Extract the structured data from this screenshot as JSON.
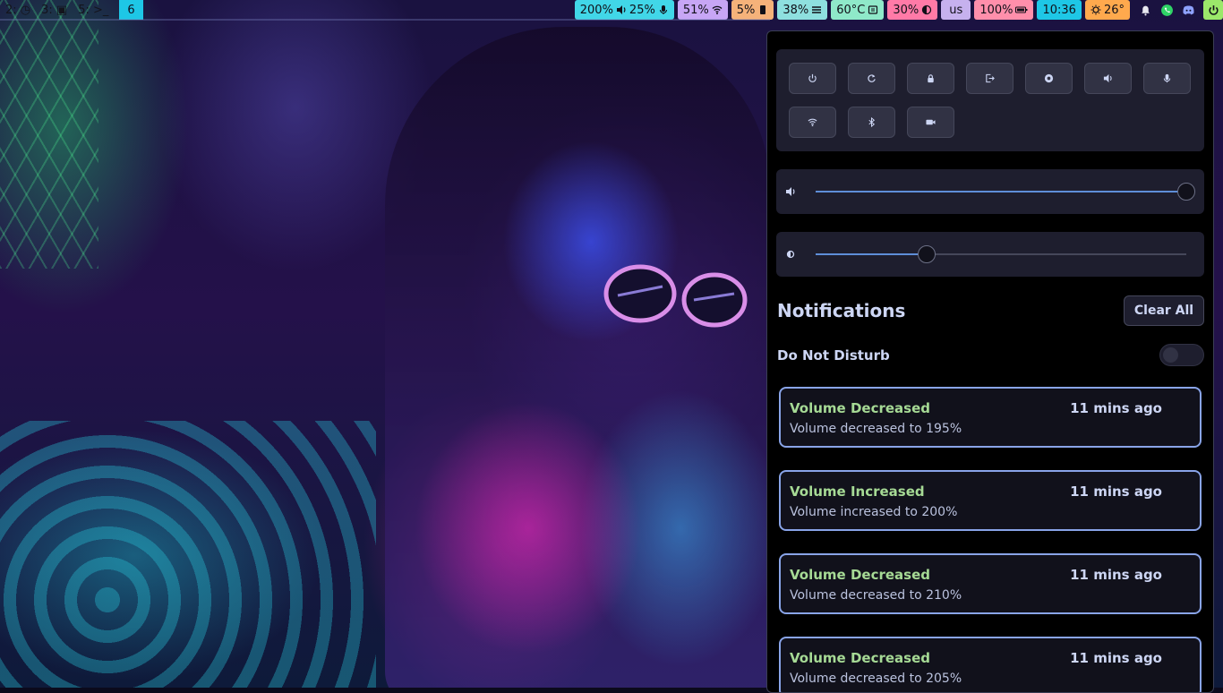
{
  "topbar": {
    "workspaces": [
      {
        "label": "2: ◷",
        "active": false
      },
      {
        "label": "3: ▣",
        "active": false
      },
      {
        "label": "5: >_",
        "active": false
      },
      {
        "label": "6",
        "active": true
      }
    ],
    "audio": {
      "speaker_volume": "200%",
      "mic_volume": "25%"
    },
    "network": {
      "signal": "51%"
    },
    "cpu": {
      "usage": "5%"
    },
    "memory": {
      "usage": "38%"
    },
    "temperature": {
      "value": "60°C"
    },
    "backlight": {
      "value": "30%"
    },
    "keyboard_layout": "us",
    "battery": {
      "value": "100%"
    },
    "clock": "10:36",
    "weather": {
      "temperature": "26°"
    },
    "tray_icons": [
      "bell-icon",
      "whatsapp-icon",
      "discord-icon"
    ],
    "colors": {
      "accent": "#1ec7e6",
      "power": "#9be86a"
    }
  },
  "panel": {
    "quick_settings": [
      {
        "name": "power-icon"
      },
      {
        "name": "reboot-icon"
      },
      {
        "name": "lock-icon"
      },
      {
        "name": "logout-icon"
      },
      {
        "name": "record-icon"
      },
      {
        "name": "speaker-icon"
      },
      {
        "name": "microphone-icon"
      },
      {
        "name": "wifi-icon"
      },
      {
        "name": "bluetooth-icon"
      },
      {
        "name": "camera-icon"
      }
    ],
    "volume_slider": {
      "icon": "speaker-icon",
      "level": 1.0
    },
    "brightness_slider": {
      "icon": "brightness-icon",
      "level": 0.3
    },
    "notifications_title": "Notifications",
    "clear_all_label": "Clear All",
    "dnd_label": "Do Not Disturb",
    "dnd_enabled": false,
    "notifications": [
      {
        "title": "Volume Decreased",
        "time": "11 mins ago",
        "body": "Volume decreased to 195%"
      },
      {
        "title": "Volume Increased",
        "time": "11 mins ago",
        "body": "Volume increased to 200%"
      },
      {
        "title": "Volume Decreased",
        "time": "11 mins ago",
        "body": "Volume decreased to 210%"
      },
      {
        "title": "Volume Decreased",
        "time": "11 mins ago",
        "body": "Volume decreased to 205%"
      }
    ],
    "colors": {
      "notif_title": "#a6da95",
      "notif_border": "#89a4e8",
      "slider_fill": "#5e8ed8"
    }
  }
}
